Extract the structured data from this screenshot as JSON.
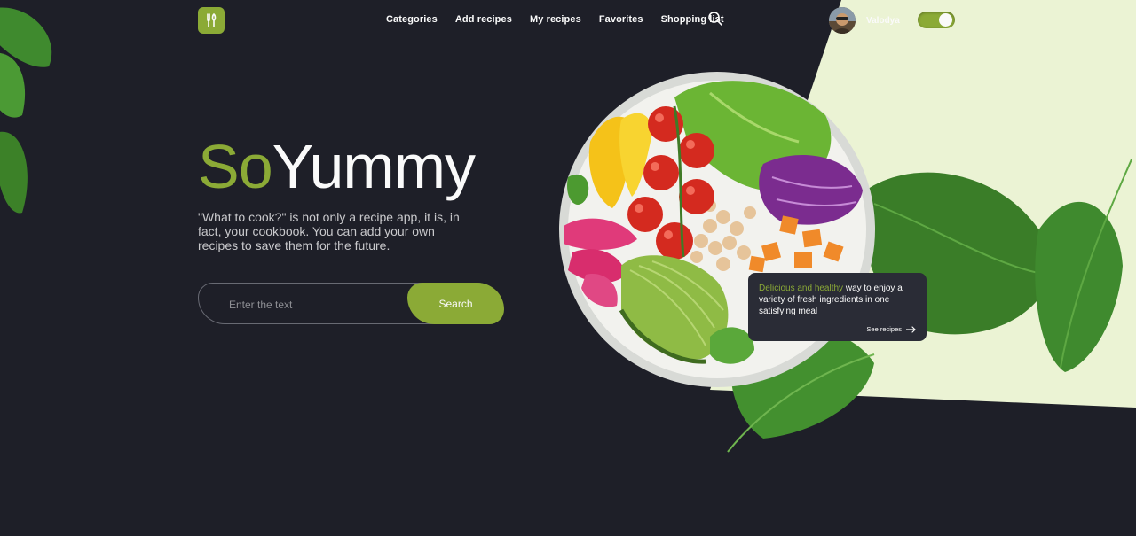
{
  "logo": {
    "icon": "fork-knife-icon",
    "color": "#8baa36"
  },
  "nav": {
    "items": [
      {
        "label": "Categories"
      },
      {
        "label": "Add recipes"
      },
      {
        "label": "My recipes"
      },
      {
        "label": "Favorites"
      },
      {
        "label": "Shopping list"
      }
    ],
    "search_icon": "search-icon"
  },
  "user": {
    "name": "Valodya"
  },
  "theme_toggle": {
    "on": true
  },
  "hero": {
    "title_accent": "So",
    "title_rest": "Yummy",
    "description": "\"What to cook?\" is not only a recipe app, it is, in fact, your cookbook. You can add your own recipes to save them for the future."
  },
  "search": {
    "placeholder": "Enter the text",
    "button_label": "Search"
  },
  "promo_card": {
    "highlight": "Delicious and healthy",
    "text": " way to enjoy a variety of fresh ingredients in one satisfying meal",
    "link_label": "See recipes"
  },
  "colors": {
    "accent": "#8baa36",
    "background": "#1e1f28",
    "light_panel": "#ebf3d4",
    "card": "#2a2c36"
  }
}
